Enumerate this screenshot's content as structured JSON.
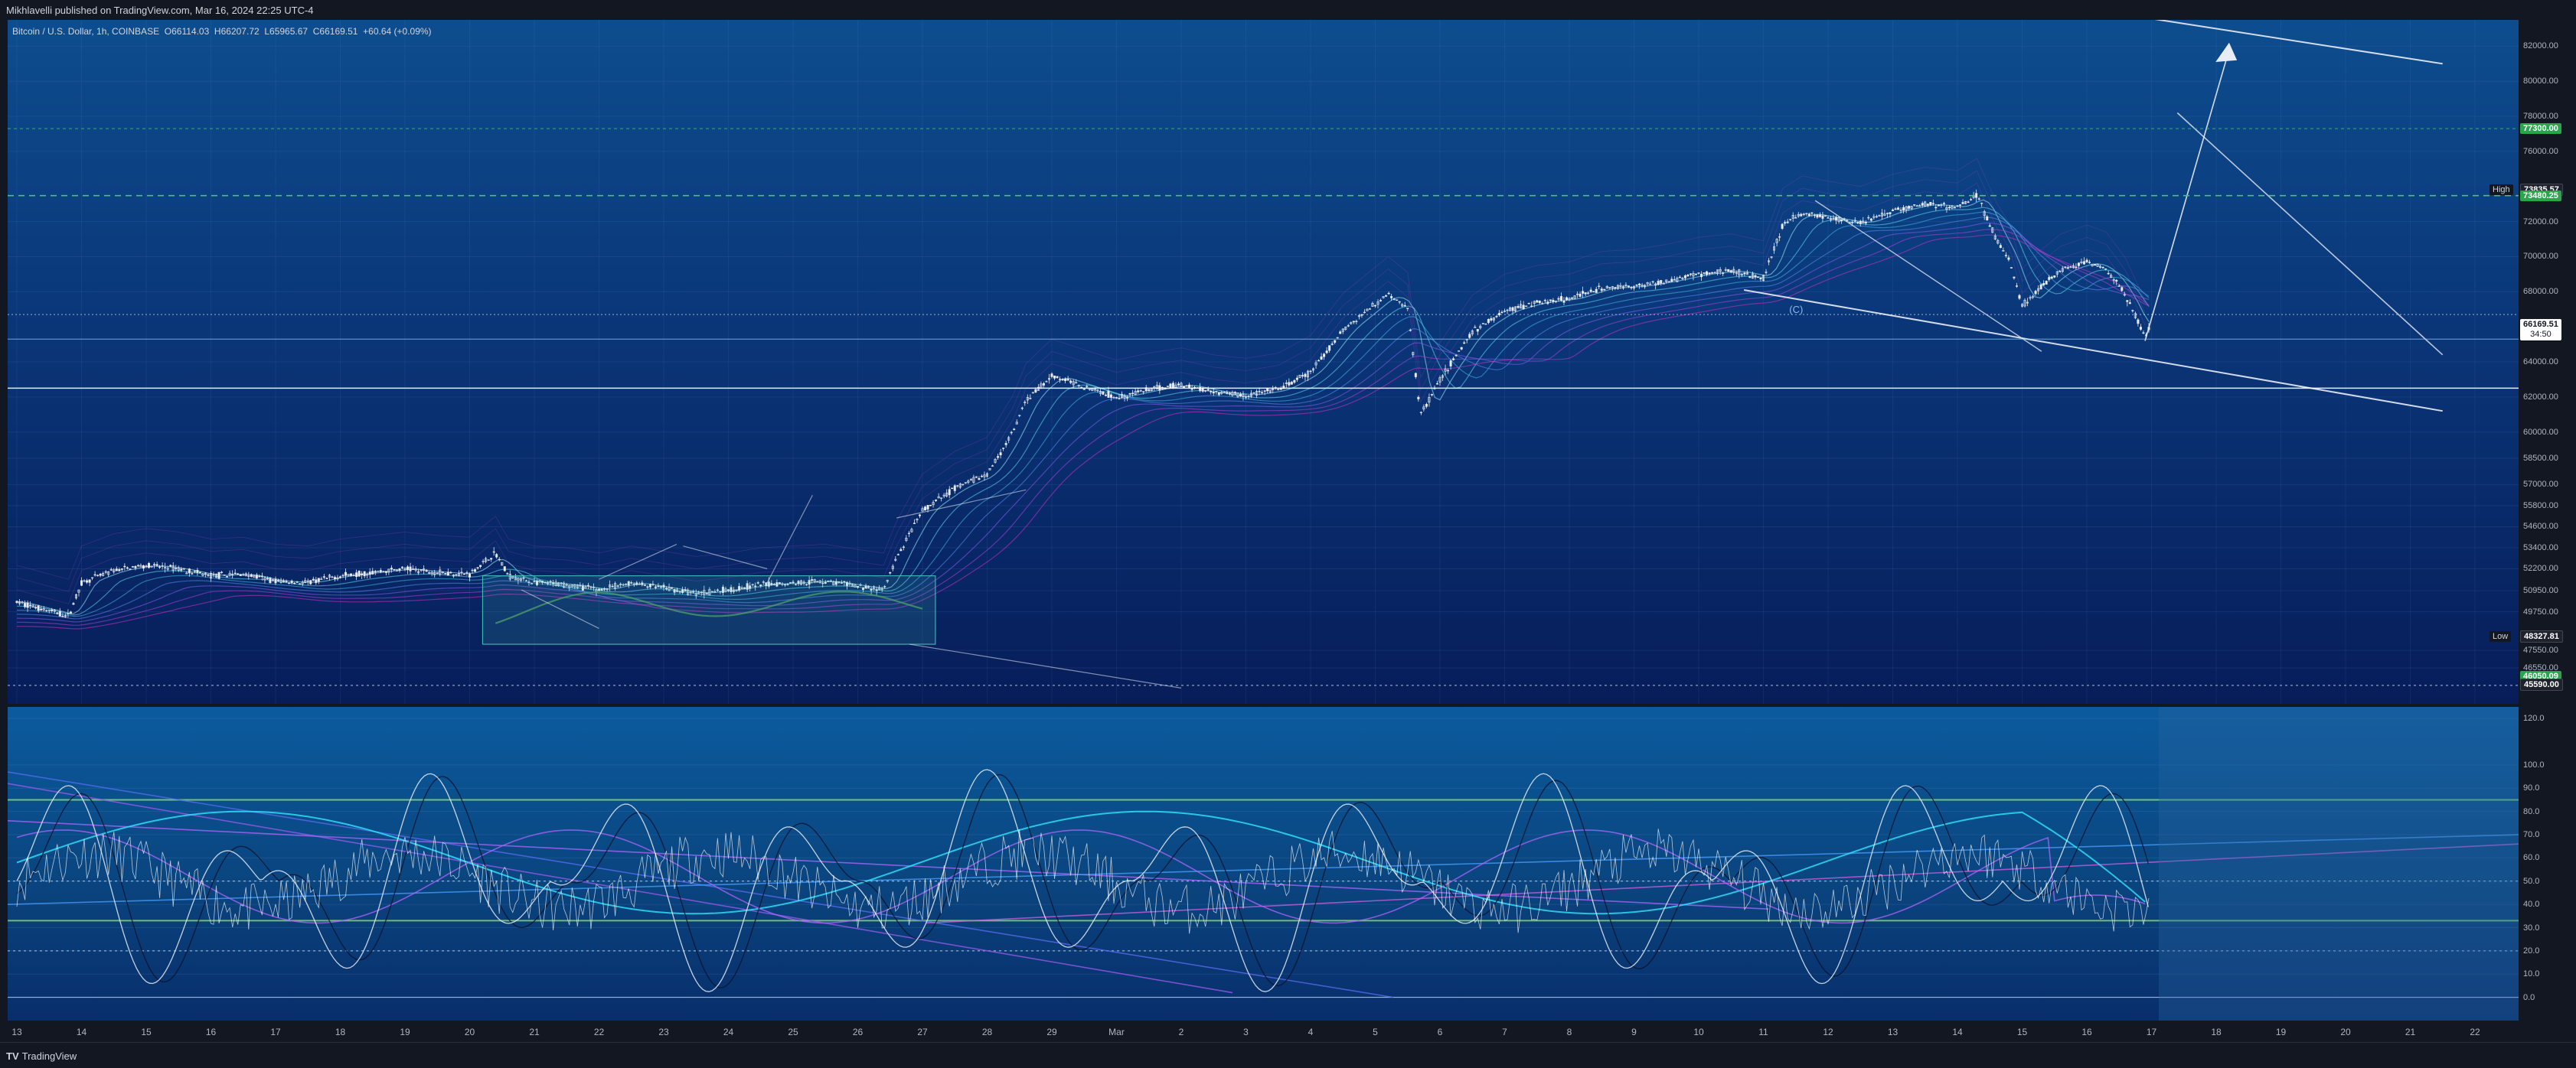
{
  "header": {
    "published": "Mikhlavelli published on TradingView.com, Mar 16, 2024 22:25 UTC-4"
  },
  "symbol": {
    "name": "Bitcoin / U.S. Dollar, 1h, COINBASE",
    "open": "66114.03",
    "high": "66207.72",
    "low": "65965.67",
    "close": "66169.51",
    "change": "+60.64 (+0.09%)"
  },
  "footer": {
    "logo_text": "TradingView"
  },
  "colors": {
    "up": "#26a69a",
    "down": "#ef5350",
    "green_tag": "#26a84a",
    "candle": "#e8eaf0",
    "ribbon_cyan": "#3fd0e8",
    "ribbon_magenta": "#c02ad0",
    "rsi_cyan": "#2ee6ff",
    "rsi_purple": "#b066ff"
  },
  "chart_data": [
    {
      "type": "candlestick",
      "interval": "1h",
      "ylim": [
        44500,
        83500
      ],
      "y_ticks": [
        "82000.00",
        "80000.00",
        "78000.00",
        "76000.00",
        "72000.00",
        "70000.00",
        "68000.00",
        "64000.00",
        "62000.00",
        "60000.00",
        "58500.00",
        "57000.00",
        "55800.00",
        "54600.00",
        "53400.00",
        "52200.00",
        "50950.00",
        "49750.00",
        "47550.00",
        "46550.00"
      ],
      "x_labels": [
        "13",
        "14",
        "15",
        "16",
        "17",
        "18",
        "19",
        "20",
        "21",
        "22",
        "23",
        "24",
        "25",
        "26",
        "27",
        "28",
        "29",
        "Mar",
        "2",
        "3",
        "4",
        "5",
        "6",
        "7",
        "8",
        "9",
        "10",
        "11",
        "12",
        "13",
        "14",
        "15",
        "16",
        "17",
        "18",
        "19",
        "20",
        "21",
        "22"
      ],
      "price_path": [
        [
          0,
          50300
        ],
        [
          0.8,
          49500
        ],
        [
          1.0,
          51400
        ],
        [
          1.5,
          52100
        ],
        [
          2,
          52400
        ],
        [
          2.5,
          52200
        ],
        [
          3,
          51800
        ],
        [
          3.5,
          51900
        ],
        [
          4,
          51500
        ],
        [
          4.5,
          51400
        ],
        [
          5,
          51800
        ],
        [
          5.5,
          52000
        ],
        [
          6,
          52200
        ],
        [
          6.5,
          52000
        ],
        [
          7,
          51900
        ],
        [
          7.4,
          53100
        ],
        [
          7.6,
          51800
        ],
        [
          8,
          51400
        ],
        [
          8.5,
          51300
        ],
        [
          9,
          51000
        ],
        [
          9.5,
          51400
        ],
        [
          10,
          51100
        ],
        [
          10.5,
          50800
        ],
        [
          11,
          51000
        ],
        [
          11.5,
          51300
        ],
        [
          12,
          51400
        ],
        [
          12.5,
          51500
        ],
        [
          13,
          51200
        ],
        [
          13.4,
          51000
        ],
        [
          13.6,
          52800
        ],
        [
          14,
          55500
        ],
        [
          14.5,
          56800
        ],
        [
          15,
          57600
        ],
        [
          15.4,
          60000
        ],
        [
          15.6,
          61800
        ],
        [
          16,
          63200
        ],
        [
          16.5,
          62600
        ],
        [
          17,
          62000
        ],
        [
          17.5,
          62400
        ],
        [
          18,
          62700
        ],
        [
          18.5,
          62300
        ],
        [
          19,
          62100
        ],
        [
          19.5,
          62400
        ],
        [
          20,
          63400
        ],
        [
          20.5,
          65800
        ],
        [
          21,
          67300
        ],
        [
          21.2,
          67900
        ],
        [
          21.5,
          67000
        ],
        [
          21.7,
          61000
        ],
        [
          22,
          63000
        ],
        [
          22.5,
          65700
        ],
        [
          23,
          66900
        ],
        [
          23.5,
          67400
        ],
        [
          24,
          67600
        ],
        [
          24.5,
          68200
        ],
        [
          25,
          68300
        ],
        [
          25.5,
          68600
        ],
        [
          26,
          69000
        ],
        [
          26.5,
          69200
        ],
        [
          27,
          68800
        ],
        [
          27.3,
          71800
        ],
        [
          27.6,
          72500
        ],
        [
          28,
          72200
        ],
        [
          28.5,
          71900
        ],
        [
          29,
          72600
        ],
        [
          29.5,
          73000
        ],
        [
          30,
          72800
        ],
        [
          30.3,
          73500
        ],
        [
          30.6,
          71000
        ],
        [
          30.8,
          69800
        ],
        [
          31,
          67200
        ],
        [
          31.3,
          68300
        ],
        [
          31.6,
          69200
        ],
        [
          32,
          69700
        ],
        [
          32.3,
          69300
        ],
        [
          32.6,
          67800
        ],
        [
          32.9,
          65400
        ],
        [
          33.0,
          66200
        ]
      ],
      "levels": [
        {
          "label": "High",
          "value": "73835.57"
        },
        {
          "label": "",
          "value": "77300.00",
          "style": "green"
        },
        {
          "label": "",
          "value": "73480.25",
          "style": "green"
        },
        {
          "label": "Low",
          "value": "48327.81"
        },
        {
          "label": "",
          "value": "46050.09",
          "style": "green"
        },
        {
          "label": "",
          "value": "45590.00"
        }
      ],
      "last_price": {
        "value": "66169.51",
        "countdown": "34:50"
      },
      "annotation": "(C)"
    },
    {
      "type": "line",
      "name": "",
      "ylim": [
        -10,
        125
      ],
      "y_ticks": [
        "120.0",
        "100.0",
        "90.0",
        "80.0",
        "70.0",
        "60.0",
        "50.0",
        "40.0",
        "30.0",
        "20.0",
        "10.0",
        "0.0"
      ]
    }
  ]
}
